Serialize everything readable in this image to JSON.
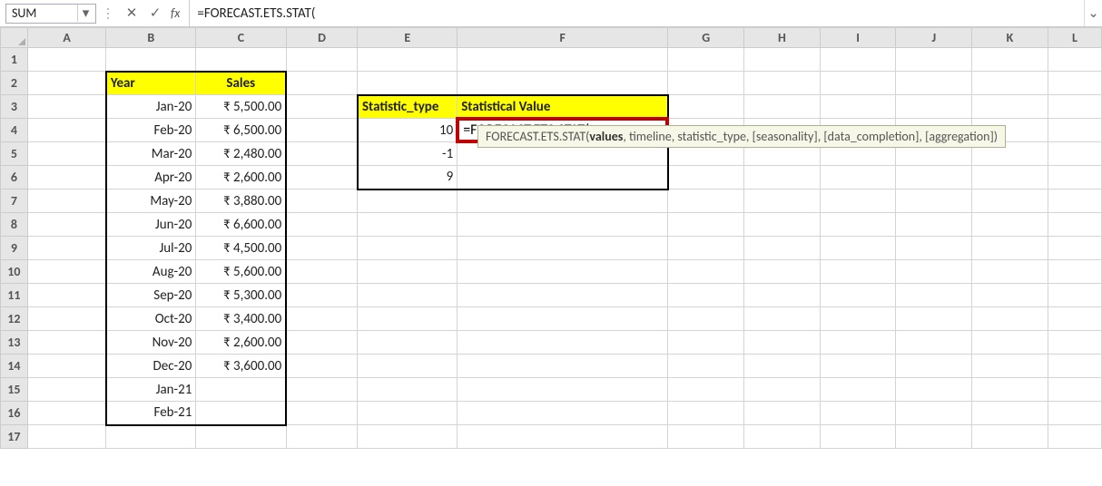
{
  "formula_bar": {
    "namebox": "SUM",
    "cancel_icon": "✕",
    "enter_icon": "✓",
    "fx_label": "fx",
    "formula": "=FORECAST.ETS.STAT(",
    "expand_icon": "⌄"
  },
  "columns": [
    "A",
    "B",
    "C",
    "D",
    "E",
    "F",
    "G",
    "H",
    "I",
    "J",
    "K",
    "L"
  ],
  "row_count": 17,
  "active_cell": {
    "col": "F",
    "row": 4
  },
  "tableBC": {
    "headers": {
      "year": "Year",
      "sales": "Sales"
    },
    "rows": [
      {
        "b": "Jan-20",
        "c": "₹ 5,500.00"
      },
      {
        "b": "Feb-20",
        "c": "₹ 6,500.00"
      },
      {
        "b": "Mar-20",
        "c": "₹ 2,480.00"
      },
      {
        "b": "Apr-20",
        "c": "₹ 2,600.00"
      },
      {
        "b": "May-20",
        "c": "₹ 3,880.00"
      },
      {
        "b": "Jun-20",
        "c": "₹ 6,600.00"
      },
      {
        "b": "Jul-20",
        "c": "₹ 4,500.00"
      },
      {
        "b": "Aug-20",
        "c": "₹ 5,600.00"
      },
      {
        "b": "Sep-20",
        "c": "₹ 5,300.00"
      },
      {
        "b": "Oct-20",
        "c": "₹ 3,400.00"
      },
      {
        "b": "Nov-20",
        "c": "₹ 2,600.00"
      },
      {
        "b": "Dec-20",
        "c": "₹ 3,600.00"
      },
      {
        "b": "Jan-21",
        "c": ""
      },
      {
        "b": "Feb-21",
        "c": ""
      }
    ]
  },
  "tableEF": {
    "headers": {
      "stat_type": "Statistic_type",
      "stat_value": "Statistical Value"
    },
    "rows": [
      {
        "e": "10",
        "f": "=FORECAST.ETS.STAT("
      },
      {
        "e": "-1",
        "f": ""
      },
      {
        "e": "9",
        "f": ""
      }
    ]
  },
  "tooltip": {
    "fn": "FORECAST.ETS.STAT(",
    "arg_bold": "values",
    "rest": ", timeline, statistic_type, [seasonality], [data_completion], [aggregation])"
  }
}
